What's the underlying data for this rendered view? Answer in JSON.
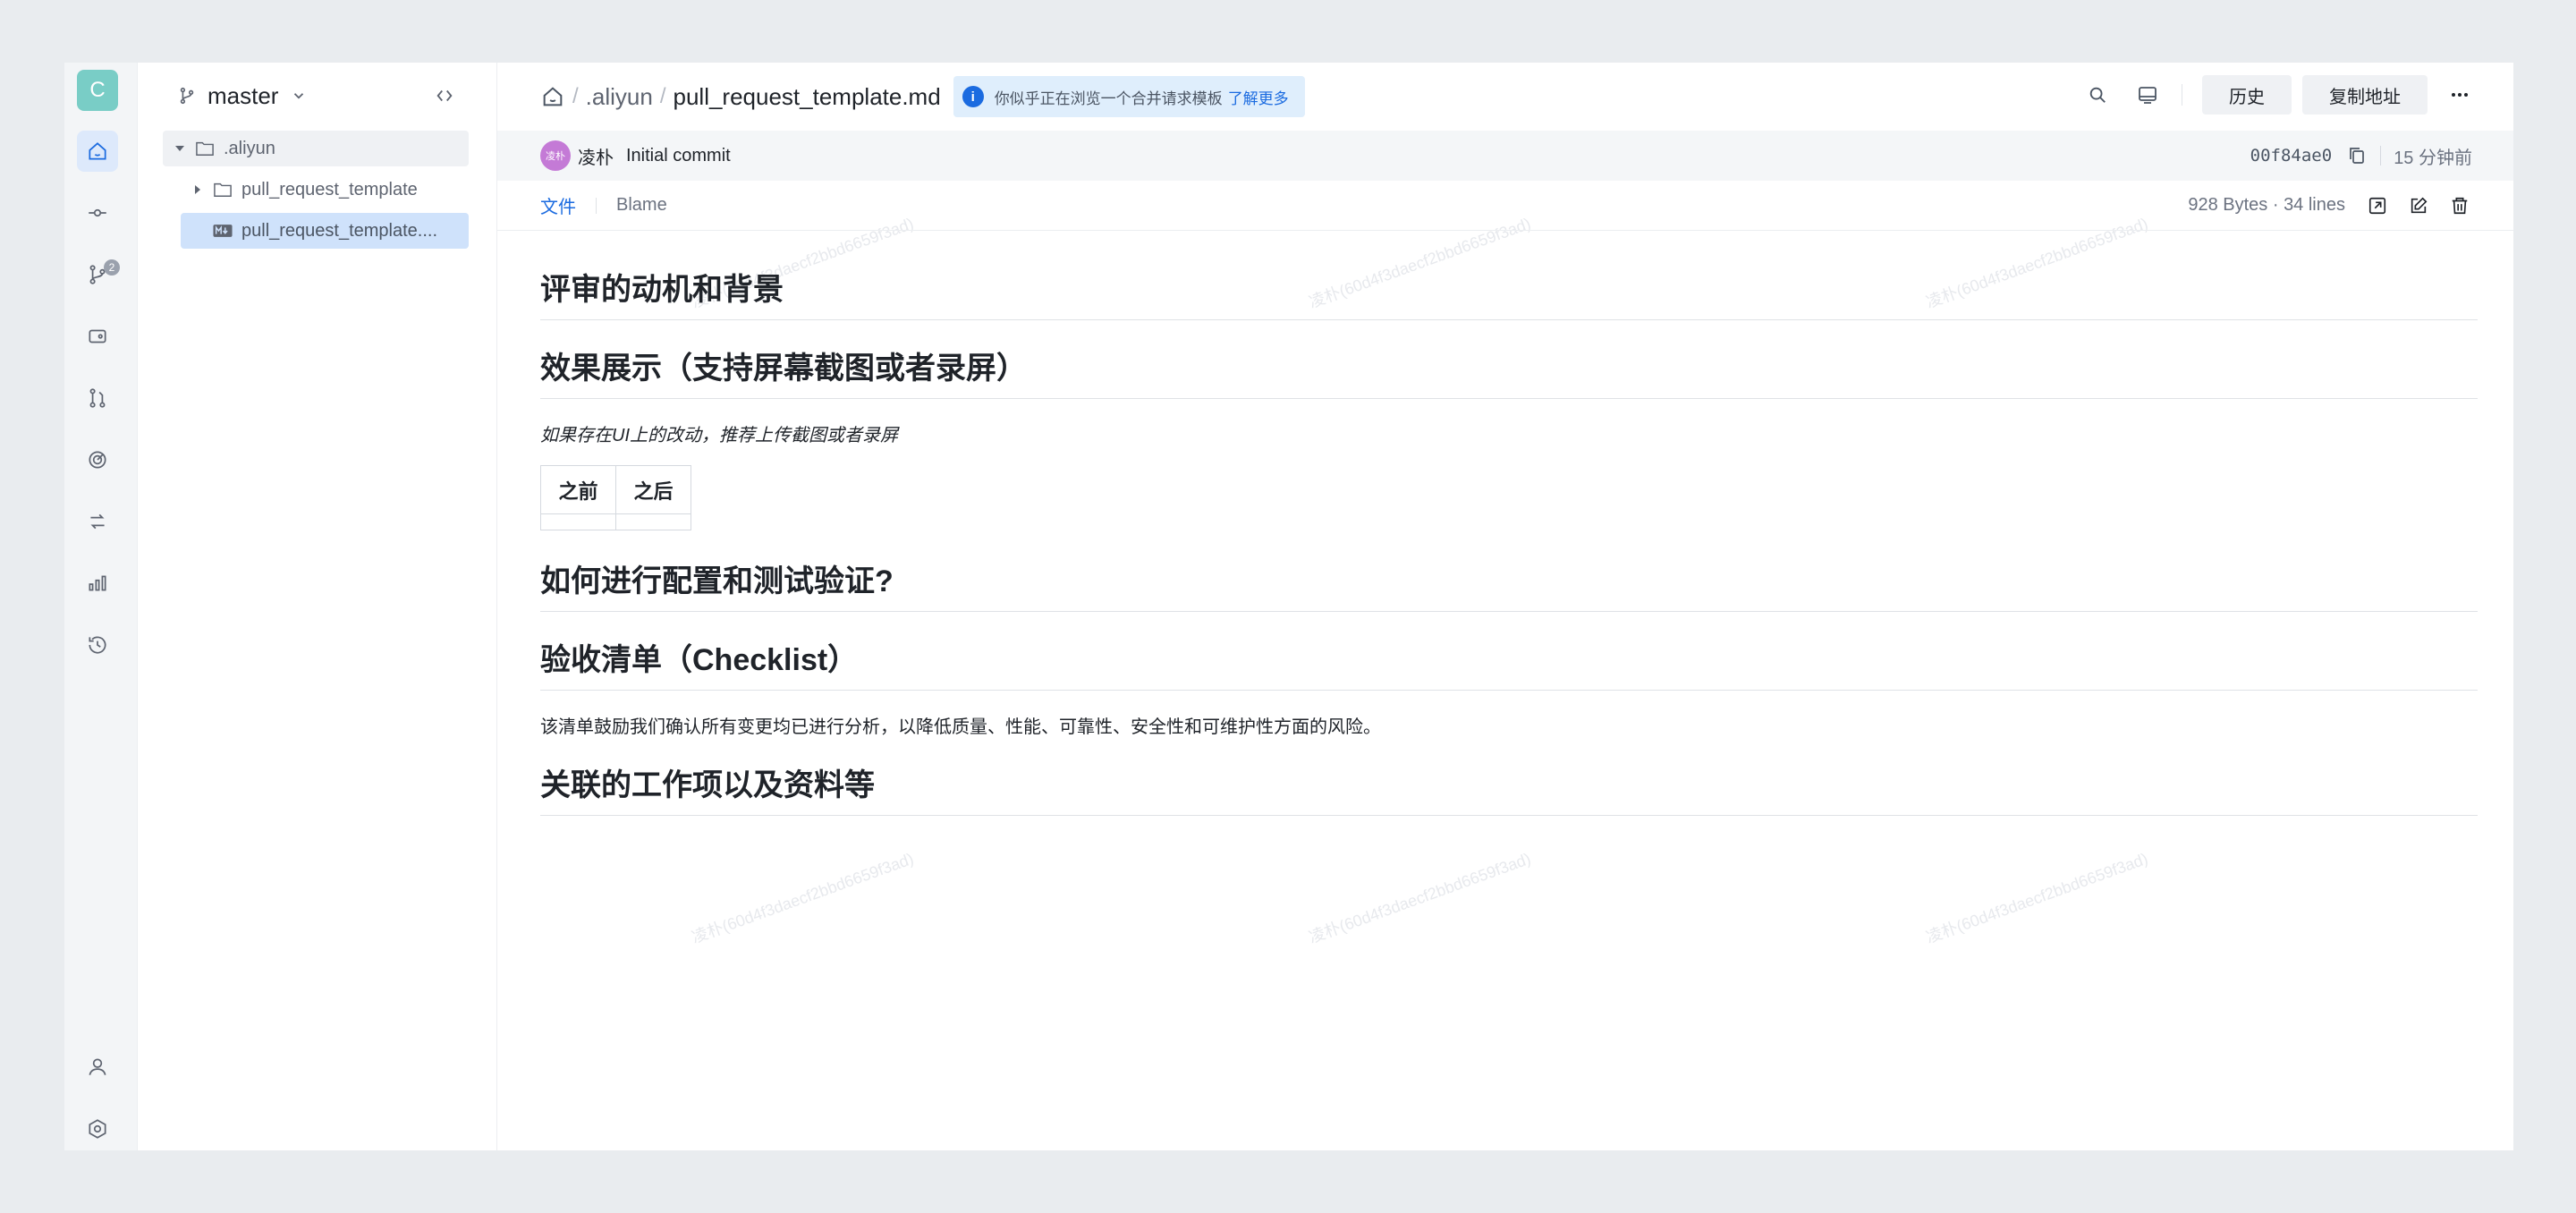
{
  "rail": {
    "avatar_letter": "C",
    "pr_badge": "2"
  },
  "tree": {
    "branch": "master",
    "items": [
      {
        "label": ".aliyun"
      },
      {
        "label": "pull_request_template"
      },
      {
        "label": "pull_request_template...."
      }
    ]
  },
  "breadcrumb": {
    "sep": "/",
    "folder": ".aliyun",
    "file": "pull_request_template.md"
  },
  "notice": {
    "icon": "i",
    "text": "你似乎正在浏览一个合并请求模板",
    "link": "了解更多"
  },
  "toolbar": {
    "history": "历史",
    "copy_address": "复制地址"
  },
  "commit": {
    "avatar_text": "凌朴",
    "author": "凌朴",
    "message": "Initial commit",
    "hash": "00f84ae0",
    "time": "15 分钟前"
  },
  "tabs": {
    "file": "文件",
    "blame": "Blame",
    "meta": "928 Bytes · 34 lines"
  },
  "doc": {
    "h1": "评审的动机和背景",
    "h2": "效果展示（支持屏幕截图或者录屏）",
    "note": "如果存在UI上的改动，推荐上传截图或者录屏",
    "table_headers": [
      "之前",
      "之后"
    ],
    "h3": "如何进行配置和测试验证?",
    "h4": "验收清单（Checklist）",
    "paragraph": "该清单鼓励我们确认所有变更均已进行分析，以降低质量、性能、可靠性、安全性和可维护性方面的风险。",
    "h5": "关联的工作项以及资料等"
  },
  "watermark": "凌朴(60d4f3daecf2bbd6659f3ad)",
  "colors": {
    "accent": "#1b6be0",
    "avatar": "#79cdc6",
    "selected_row": "#cfe2fb"
  }
}
